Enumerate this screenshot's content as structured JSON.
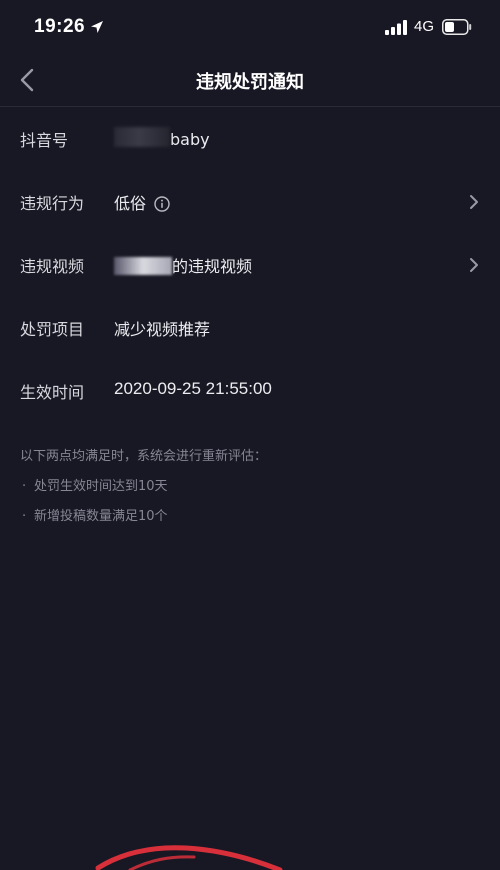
{
  "status_bar": {
    "time": "19:26",
    "network": "4G"
  },
  "nav": {
    "title": "违规处罚通知"
  },
  "rows": [
    {
      "label": "抖音号",
      "value": "baby"
    },
    {
      "label": "违规行为",
      "value": "低俗"
    },
    {
      "label": "违规视频",
      "value": "的违规视频"
    },
    {
      "label": "处罚项目",
      "value": "减少视频推荐"
    },
    {
      "label": "生效时间",
      "value": "2020-09-25 21:55:00"
    }
  ],
  "notes": {
    "intro": "以下两点均满足时，系统会进行重新评估：",
    "items": [
      "处罚生效时间达到10天",
      "新增投稿数量满足10个"
    ],
    "bullet": "·"
  },
  "colors": {
    "background": "#181824",
    "annotation": "#d8303a"
  }
}
